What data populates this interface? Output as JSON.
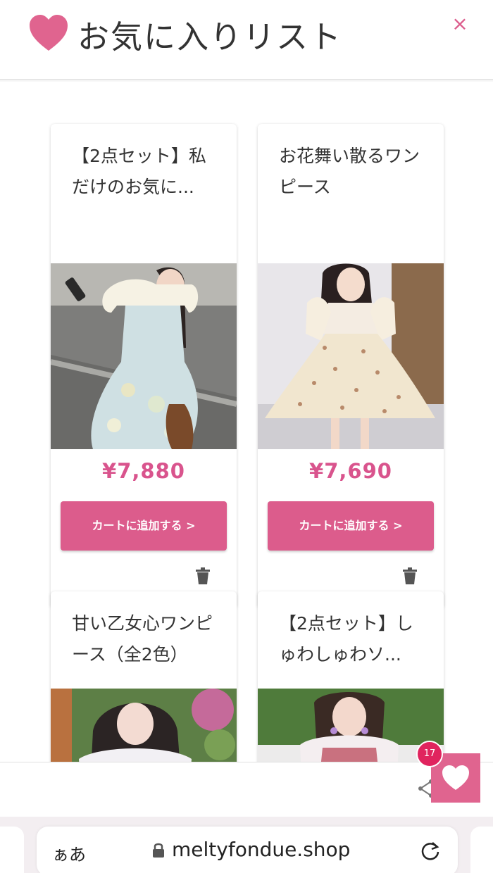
{
  "header": {
    "title": "お気に入りリスト",
    "close": "×"
  },
  "products": [
    {
      "name": "【2点セット】私だけのお気に...",
      "price": "¥7,880",
      "cart_label": "カートに追加する >"
    },
    {
      "name": "お花舞い散るワンピース",
      "price": "¥7,690",
      "cart_label": "カートに追加する >"
    },
    {
      "name": "甘い乙女心ワンピース（全2色）",
      "price": "",
      "cart_label": ""
    },
    {
      "name": "【2点セット】しゅわしゅわソ...",
      "price": "",
      "cart_label": ""
    }
  ],
  "favorites": {
    "count": "17"
  },
  "browser": {
    "text_size": "ぁあ",
    "url": "meltyfondue.shop"
  },
  "colors": {
    "accent": "#dc5c8c",
    "price": "#d9548d",
    "badge": "#e0245e"
  },
  "icons": [
    "heart-icon",
    "close-icon",
    "trash-icon",
    "share-icon",
    "lock-icon",
    "reload-icon"
  ]
}
